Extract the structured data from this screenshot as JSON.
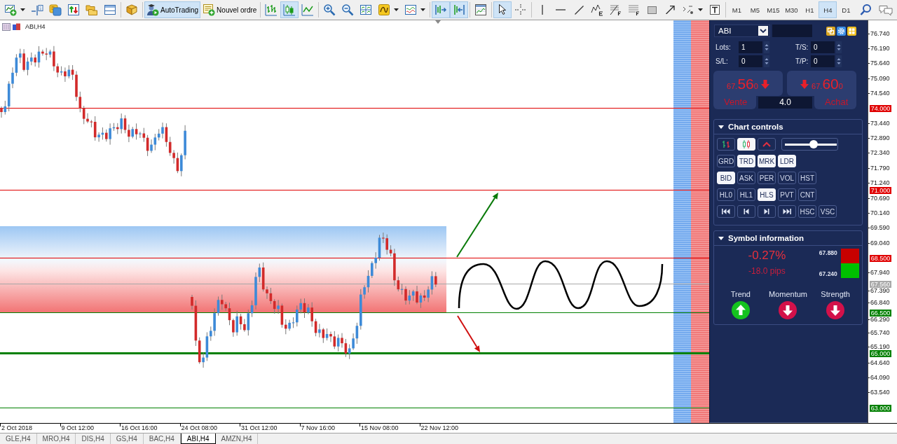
{
  "toolbar": {
    "buttons": [
      {
        "kind": "newchart",
        "selected": false
      },
      {
        "kind": "profiles",
        "selected": false
      },
      {
        "kind": "market",
        "selected": false
      },
      {
        "kind": "data",
        "selected": false
      },
      {
        "kind": "navigator",
        "selected": false
      },
      {
        "kind": "terminal",
        "selected": false
      },
      {
        "kind": "tester",
        "selected": false
      },
      {
        "kind": "autotrading",
        "label": "AutoTrading",
        "selected": true
      },
      {
        "kind": "order",
        "label": "Nouvel ordre",
        "selected": false
      },
      {
        "kind": "bars",
        "selected": false
      },
      {
        "kind": "candles",
        "selected": true
      },
      {
        "kind": "line",
        "selected": false
      },
      {
        "kind": "zoomin",
        "selected": false
      },
      {
        "kind": "zoomout",
        "selected": false
      },
      {
        "kind": "tile",
        "selected": false
      },
      {
        "kind": "indicators",
        "selected": false
      },
      {
        "kind": "periods",
        "selected": false
      },
      {
        "kind": "autoscroll",
        "selected": true
      },
      {
        "kind": "shift",
        "selected": true
      },
      {
        "kind": "properties",
        "selected": false
      },
      {
        "kind": "cursor",
        "selected": true
      },
      {
        "kind": "crosshair",
        "selected": false
      },
      {
        "kind": "vline",
        "selected": false
      },
      {
        "kind": "hline",
        "selected": false
      },
      {
        "kind": "trendline",
        "selected": false
      },
      {
        "kind": "elliott",
        "selected": false
      },
      {
        "kind": "fibo",
        "selected": false
      },
      {
        "kind": "fibofan",
        "selected": false
      },
      {
        "kind": "rectangle",
        "selected": false
      },
      {
        "kind": "arrow",
        "selected": false
      },
      {
        "kind": "shapes",
        "selected": false
      },
      {
        "kind": "text",
        "selected": false
      }
    ],
    "timeframes": [
      {
        "label": "M1",
        "selected": false
      },
      {
        "label": "M5",
        "selected": false
      },
      {
        "label": "M15",
        "selected": false
      },
      {
        "label": "M30",
        "selected": false
      },
      {
        "label": "H1",
        "selected": false
      },
      {
        "label": "H4",
        "selected": true
      },
      {
        "label": "D1",
        "selected": false
      }
    ]
  },
  "chart": {
    "symbol_label": "ABI,H4",
    "price_ticks": [
      "76.740",
      "76.190",
      "75.640",
      "75.090",
      "74.540",
      "73.440",
      "72.890",
      "72.340",
      "71.790",
      "71.240",
      "70.690",
      "70.140",
      "69.590",
      "69.040",
      "67.940",
      "67.390",
      "66.840",
      "66.290",
      "65.740",
      "65.190",
      "64.640",
      "64.090",
      "63.540"
    ],
    "levels": [
      {
        "price": "74.000",
        "color": "#e00000",
        "thick": false
      },
      {
        "price": "71.000",
        "color": "#e00000",
        "thick": false
      },
      {
        "price": "68.500",
        "color": "#e00000",
        "thick": false
      },
      {
        "price": "67.560",
        "color": "#a8a8a8",
        "thick": false
      },
      {
        "price": "66.500",
        "color": "#008000",
        "thick": false
      },
      {
        "price": "65.000",
        "color": "#008000",
        "thick": true
      },
      {
        "price": "63.000",
        "color": "#008000",
        "thick": false
      }
    ],
    "time_labels": [
      "2 Oct 2018",
      "9 Oct 12:00",
      "16 Oct 16:00",
      "24 Oct 08:00",
      "31 Oct 12:00",
      "7 Nov 16:00",
      "15 Nov 08:00",
      "22 Nov 12:00"
    ]
  },
  "trade_panel": {
    "symbol": "ABI",
    "fields": [
      {
        "label": "Lots:",
        "value": "1"
      },
      {
        "label": "T/S:",
        "value": "0"
      },
      {
        "label": "S/L:",
        "value": "0"
      },
      {
        "label": "T/P:",
        "value": "0"
      }
    ],
    "sell": {
      "price_start": "67.",
      "price_pips": "56",
      "price_end": "0",
      "kind": "down",
      "label": "Vente"
    },
    "buy": {
      "price_start": "67.",
      "price_pips": "60",
      "price_end": "0",
      "kind": "down",
      "label": "Achat"
    },
    "spread": "4.0"
  },
  "chart_controls": {
    "title": "Chart controls",
    "expanded": true,
    "chart_types": [
      {
        "kind": "bars",
        "selected": false
      },
      {
        "kind": "candles",
        "selected": true
      },
      {
        "kind": "line",
        "selected": false
      }
    ],
    "zoom": {
      "level": 0.57
    },
    "rows": [
      [
        {
          "kind": "text",
          "label": "GRD",
          "selected": false
        },
        {
          "kind": "text",
          "label": "TRD",
          "selected": true
        },
        {
          "kind": "text",
          "label": "MRK",
          "selected": true
        },
        {
          "kind": "text",
          "label": "LDR",
          "selected": true
        }
      ],
      [
        {
          "kind": "text",
          "label": "BID",
          "selected": true
        },
        {
          "kind": "text",
          "label": "ASK",
          "selected": false
        },
        {
          "kind": "text",
          "label": "PER",
          "selected": false
        },
        {
          "kind": "text",
          "label": "VOL",
          "selected": false
        },
        {
          "kind": "text",
          "label": "HST",
          "selected": false
        }
      ],
      [
        {
          "kind": "text",
          "label": "HL0",
          "selected": false
        },
        {
          "kind": "text",
          "label": "HL1",
          "selected": false
        },
        {
          "kind": "text",
          "label": "HLS",
          "selected": true
        },
        {
          "kind": "text",
          "label": "PVT",
          "selected": false
        },
        {
          "kind": "text",
          "label": "CNT",
          "selected": false
        }
      ],
      [
        {
          "kind": "first",
          "selected": false
        },
        {
          "kind": "prev",
          "selected": false
        },
        {
          "kind": "next",
          "selected": false
        },
        {
          "kind": "last",
          "selected": false
        },
        {
          "kind": "text",
          "label": "HSC",
          "selected": false
        },
        {
          "kind": "text",
          "label": "VSC",
          "selected": false
        }
      ]
    ]
  },
  "symbol_info": {
    "title": "Symbol information",
    "expanded": true,
    "change": "-0.27%",
    "pips": "-18.0 pips",
    "high": "67.880",
    "low": "67.240",
    "signals": [
      {
        "label": "Trend",
        "kind": "up",
        "color": "#14c21e"
      },
      {
        "label": "Momentum",
        "kind": "down",
        "color": "#d3114a"
      },
      {
        "label": "Strength",
        "kind": "down",
        "color": "#d3114a"
      }
    ]
  },
  "tabs": [
    {
      "label": "GLE,H4",
      "selected": false
    },
    {
      "label": "MRO,H4",
      "selected": false
    },
    {
      "label": "DIS,H4",
      "selected": false
    },
    {
      "label": "GS,H4",
      "selected": false
    },
    {
      "label": "BAC,H4",
      "selected": false
    },
    {
      "label": "ABI,H4",
      "selected": true
    },
    {
      "label": "AMZN,H4",
      "selected": false
    }
  ]
}
